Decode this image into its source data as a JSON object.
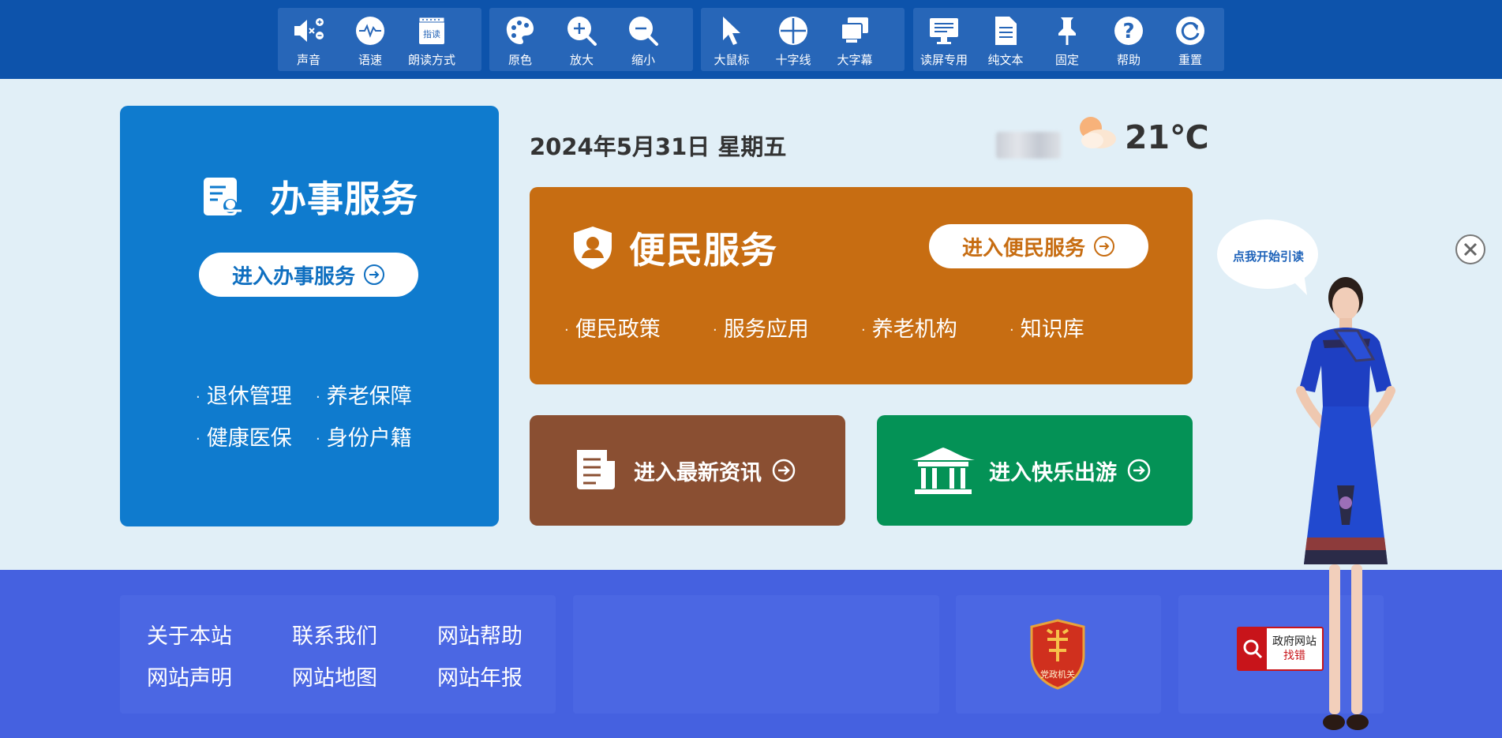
{
  "toolbar": {
    "groups": [
      [
        {
          "icon": "speaker-icon",
          "label": "声音"
        },
        {
          "icon": "speed-icon",
          "label": "语速"
        },
        {
          "icon": "read-mode-icon",
          "label": "朗读方式",
          "icon_text": "指读"
        }
      ],
      [
        {
          "icon": "palette-icon",
          "label": "原色"
        },
        {
          "icon": "zoom-in-icon",
          "label": "放大"
        },
        {
          "icon": "zoom-out-icon",
          "label": "缩小"
        }
      ],
      [
        {
          "icon": "cursor-icon",
          "label": "大鼠标"
        },
        {
          "icon": "crosshair-icon",
          "label": "十字线"
        },
        {
          "icon": "big-caption-icon",
          "label": "大字幕"
        }
      ],
      [
        {
          "icon": "screen-reader-icon",
          "label": "读屏专用"
        },
        {
          "icon": "document-icon",
          "label": "纯文本"
        },
        {
          "icon": "pin-icon",
          "label": "固定"
        },
        {
          "icon": "help-icon",
          "label": "帮助"
        },
        {
          "icon": "reset-icon",
          "label": "重置"
        }
      ]
    ]
  },
  "services_card": {
    "title": "办事服务",
    "button": "进入办事服务",
    "links": [
      "退休管理",
      "养老保障",
      "健康医保",
      "身份户籍"
    ]
  },
  "date": "2024年5月31日 星期五",
  "weather": {
    "temperature": "21℃",
    "icon": "partly-cloudy-icon"
  },
  "convenience_card": {
    "title": "便民服务",
    "button": "进入便民服务",
    "links": [
      "便民政策",
      "服务应用",
      "养老机构",
      "知识库"
    ]
  },
  "news_card": {
    "label": "进入最新资讯"
  },
  "travel_card": {
    "label": "进入快乐出游"
  },
  "footer": {
    "links": [
      "关于本站",
      "联系我们",
      "网站帮助",
      "网站声明",
      "网站地图",
      "网站年报"
    ],
    "emblem_text": "党政机关",
    "find_error": {
      "line1": "政府网站",
      "line2": "找错"
    }
  },
  "guide": {
    "bubble": "点我开始引读"
  },
  "colors": {
    "toolbar_bg": "#0d53ab",
    "page_bg": "#e1eff7",
    "blue_card": "#0f7bce",
    "orange_card": "#c76d12",
    "brown_card": "#8a4f32",
    "green_card": "#049256",
    "footer_bg": "#4561e0"
  }
}
